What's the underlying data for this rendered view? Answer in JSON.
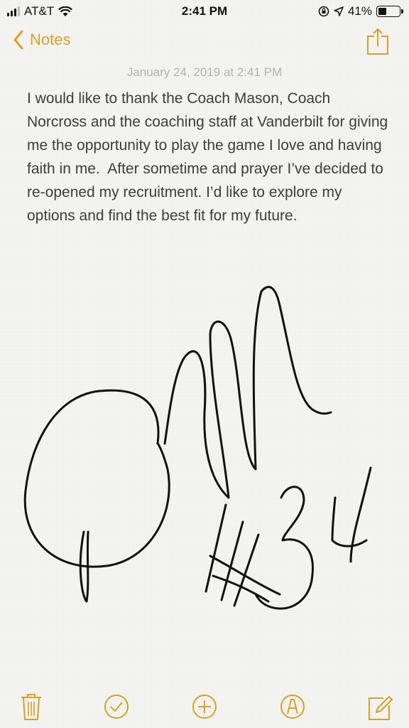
{
  "status_bar": {
    "carrier": "AT&T",
    "time": "2:41 PM",
    "battery_percent": "41%",
    "battery_level": 0.41,
    "icons": [
      "signal-bars-icon",
      "wifi-icon",
      "orientation-lock-icon",
      "location-arrow-icon",
      "battery-icon"
    ]
  },
  "nav": {
    "back_label": "Notes",
    "accent_color": "#d9a021"
  },
  "note": {
    "date": "January 24, 2019 at 2:41 PM",
    "body": "I would like to thank the Coach Mason, Coach Norcross and the coaching staff at Vanderbilt for giving me the opportunity to play the game I love and having faith in me.  After sometime and prayer I’ve decided to re-opened my recruitment. I’d like to explore my options and find the best fit for my future."
  },
  "toolbar": {
    "icons": [
      "trash-icon",
      "checklist-icon",
      "add-icon",
      "markup-pen-icon",
      "compose-icon"
    ]
  }
}
